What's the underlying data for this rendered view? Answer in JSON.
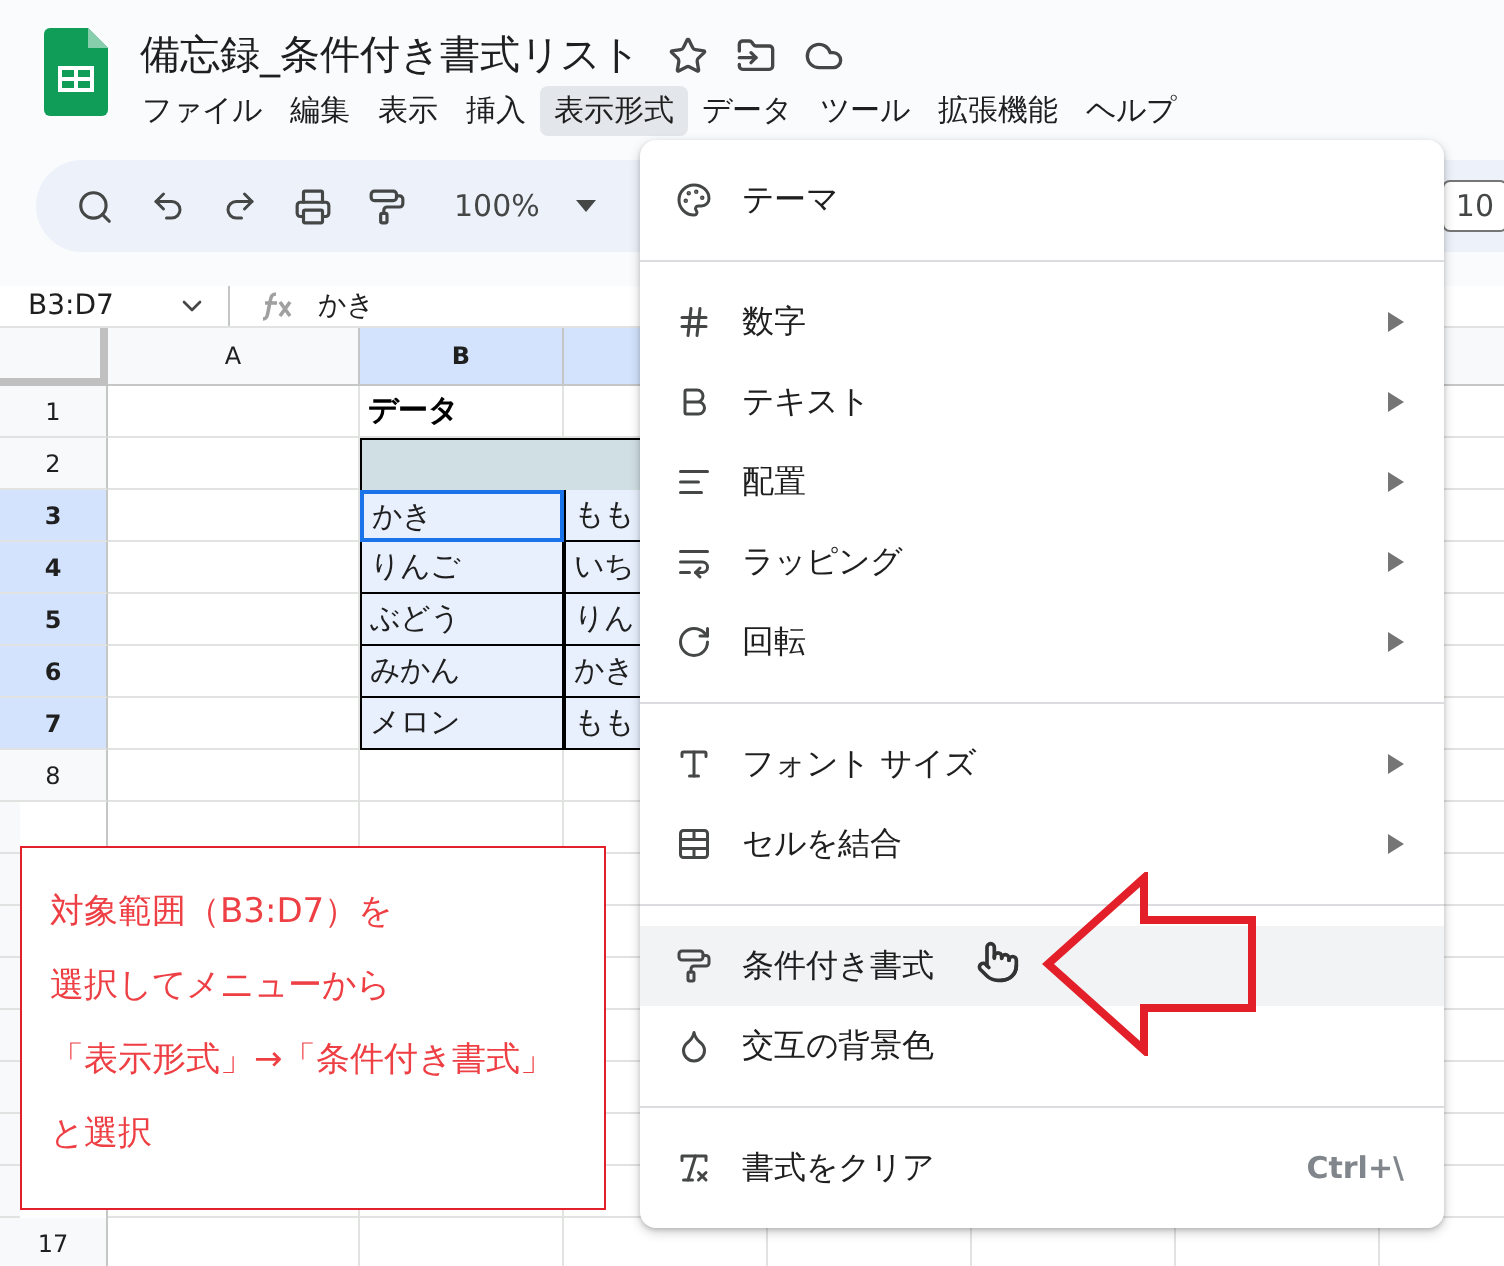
{
  "document": {
    "title": "備忘録_条件付き書式リスト"
  },
  "menu_bar": [
    {
      "label": "ファイル",
      "selected": false
    },
    {
      "label": "編集",
      "selected": false
    },
    {
      "label": "表示",
      "selected": false
    },
    {
      "label": "挿入",
      "selected": false
    },
    {
      "label": "表示形式",
      "selected": true
    },
    {
      "label": "データ",
      "selected": false
    },
    {
      "label": "ツール",
      "selected": false
    },
    {
      "label": "拡張機能",
      "selected": false
    },
    {
      "label": "ヘルプ",
      "selected": false
    }
  ],
  "toolbar": {
    "zoom": "100%",
    "font_size": "10"
  },
  "formula_bar": {
    "name_box": "B3:D7",
    "formula": "かき"
  },
  "columns": [
    {
      "label": "A",
      "selected": false
    },
    {
      "label": "B",
      "selected": true
    },
    {
      "selected": true
    }
  ],
  "rows": [
    {
      "label": "1",
      "selected": false,
      "kind": "title",
      "text": "データ"
    },
    {
      "label": "2",
      "selected": false,
      "kind": "band"
    },
    {
      "label": "3",
      "selected": true,
      "kind": "data",
      "cells": [
        {
          "text": "かき",
          "active": true
        },
        {
          "text": "もも",
          "active": false
        }
      ]
    },
    {
      "label": "4",
      "selected": true,
      "kind": "data",
      "cells": [
        {
          "text": "りんご",
          "active": false
        },
        {
          "text": "いち",
          "active": false
        }
      ]
    },
    {
      "label": "5",
      "selected": true,
      "kind": "data",
      "cells": [
        {
          "text": "ぶどう",
          "active": false
        },
        {
          "text": "りん",
          "active": false
        }
      ]
    },
    {
      "label": "6",
      "selected": true,
      "kind": "data",
      "cells": [
        {
          "text": "みかん",
          "active": false
        },
        {
          "text": "かき",
          "active": false
        }
      ]
    },
    {
      "label": "7",
      "selected": true,
      "kind": "data",
      "cells": [
        {
          "text": "メロン",
          "active": false
        },
        {
          "text": "もも",
          "active": false
        }
      ]
    },
    {
      "label": "8",
      "selected": false,
      "kind": "empty"
    },
    {
      "kind": "empty"
    },
    {
      "kind": "empty"
    },
    {
      "kind": "empty"
    },
    {
      "kind": "empty"
    },
    {
      "kind": "empty"
    },
    {
      "kind": "empty"
    },
    {
      "kind": "empty"
    },
    {
      "kind": "empty"
    },
    {
      "label": "17",
      "selected": false,
      "kind": "empty"
    }
  ],
  "format_menu": [
    {
      "kind": "item",
      "label": "テーマ",
      "has_submenu": false,
      "highlighted": false
    },
    {
      "kind": "divider"
    },
    {
      "kind": "item",
      "label": "数字",
      "has_submenu": true,
      "highlighted": false
    },
    {
      "kind": "item",
      "label": "テキスト",
      "has_submenu": true,
      "highlighted": false
    },
    {
      "kind": "item",
      "label": "配置",
      "has_submenu": true,
      "highlighted": false
    },
    {
      "kind": "item",
      "label": "ラッピング",
      "has_submenu": true,
      "highlighted": false
    },
    {
      "kind": "item",
      "label": "回転",
      "has_submenu": true,
      "highlighted": false
    },
    {
      "kind": "divider"
    },
    {
      "kind": "item",
      "label": "フォント サイズ",
      "has_submenu": true,
      "highlighted": false
    },
    {
      "kind": "item",
      "label": "セルを結合",
      "has_submenu": true,
      "highlighted": false
    },
    {
      "kind": "divider"
    },
    {
      "kind": "item",
      "label": "条件付き書式",
      "has_submenu": false,
      "highlighted": true
    },
    {
      "kind": "item",
      "label": "交互の背景色",
      "has_submenu": false,
      "highlighted": false
    },
    {
      "kind": "divider"
    },
    {
      "kind": "item",
      "label": "書式をクリア",
      "has_submenu": false,
      "highlighted": false,
      "shortcut": "Ctrl+\\"
    }
  ],
  "callout": {
    "lines": [
      "対象範囲（B3:D7）を",
      "選択してメニューから",
      "「表示形式」→「条件付き書式」",
      "と選択"
    ]
  }
}
